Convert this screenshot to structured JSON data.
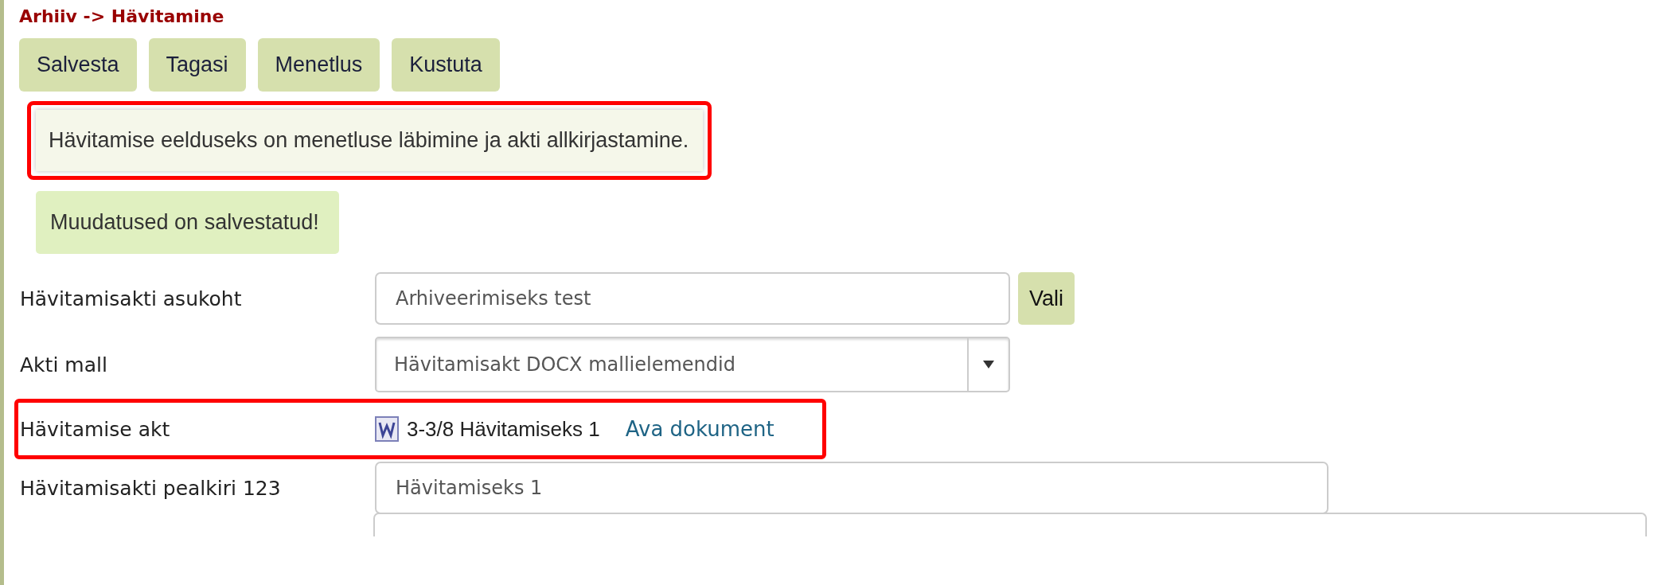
{
  "title": "Arhiiv -> Hävitamine",
  "buttons": [
    "Salvesta",
    "Tagasi",
    "Menetlus",
    "Kustuta"
  ],
  "info": {
    "text": "Hävitamise eelduseks on menetluse läbimine ja akti allkirjastamine.",
    "highlighted": true
  },
  "success": {
    "text": "Muudatused on salvestatud!"
  },
  "fields": [
    {
      "kind": "input",
      "label": "Hävitamisakti asukoht",
      "value": "Arhiveerimiseks test",
      "button": "Vali",
      "highlighted": false
    },
    {
      "kind": "select",
      "label": "Akti mall",
      "value": "Hävitamisakt DOCX mallielemendid",
      "highlighted": false
    },
    {
      "kind": "document",
      "label": "Hävitamise akt",
      "document": "3-3/8 Hävitamiseks 1",
      "link": "Ava dokument",
      "highlighted": true
    },
    {
      "kind": "input",
      "label": "Hävitamisakti pealkiri 123",
      "value": "Hävitamiseks 1",
      "highlighted": false
    },
    {
      "kind": "partial-input",
      "highlighted": false
    }
  ]
}
